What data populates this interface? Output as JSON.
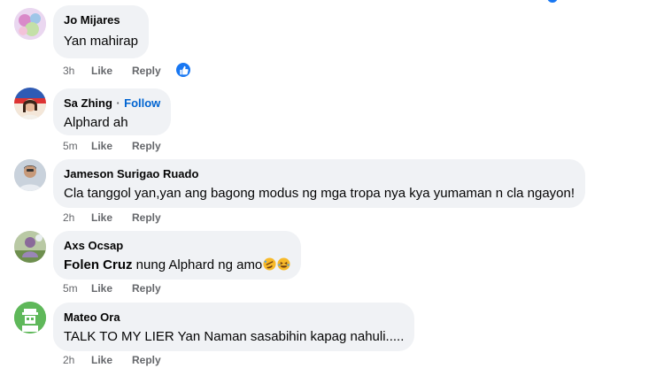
{
  "comments": [
    {
      "name": "Jo Mijares",
      "text": "Yan mahirap",
      "time": "3h",
      "like": "Like",
      "reply": "Reply",
      "reaction_icon": "like-icon"
    },
    {
      "name": "Sa Zhing",
      "follow_sep": "·",
      "follow": "Follow",
      "text": "Alphard ah",
      "time": "5m",
      "like": "Like",
      "reply": "Reply"
    },
    {
      "name": "Jameson Surigao Ruado",
      "text": "Cla tanggol yan,yan ang bagong modus ng mga tropa nya kya yumaman n cla ngayon!",
      "time": "2h",
      "like": "Like",
      "reply": "Reply"
    },
    {
      "name": "Axs Ocsap",
      "mention": "Folen Cruz",
      "text": " nung Alphard ng amo",
      "emojis": [
        "rofl-emoji",
        "laughing-emoji"
      ],
      "time": "5m",
      "like": "Like",
      "reply": "Reply"
    },
    {
      "name": "Mateo Ora",
      "text": "TALK TO MY LIER Yan Naman sasabihin kapag nahuli.....",
      "time": "2h",
      "like": "Like",
      "reply": "Reply"
    }
  ],
  "colors": {
    "bubble": "#f0f2f5",
    "link": "#0064d1",
    "meta": "#65676b",
    "reaction": "#1877f2"
  }
}
